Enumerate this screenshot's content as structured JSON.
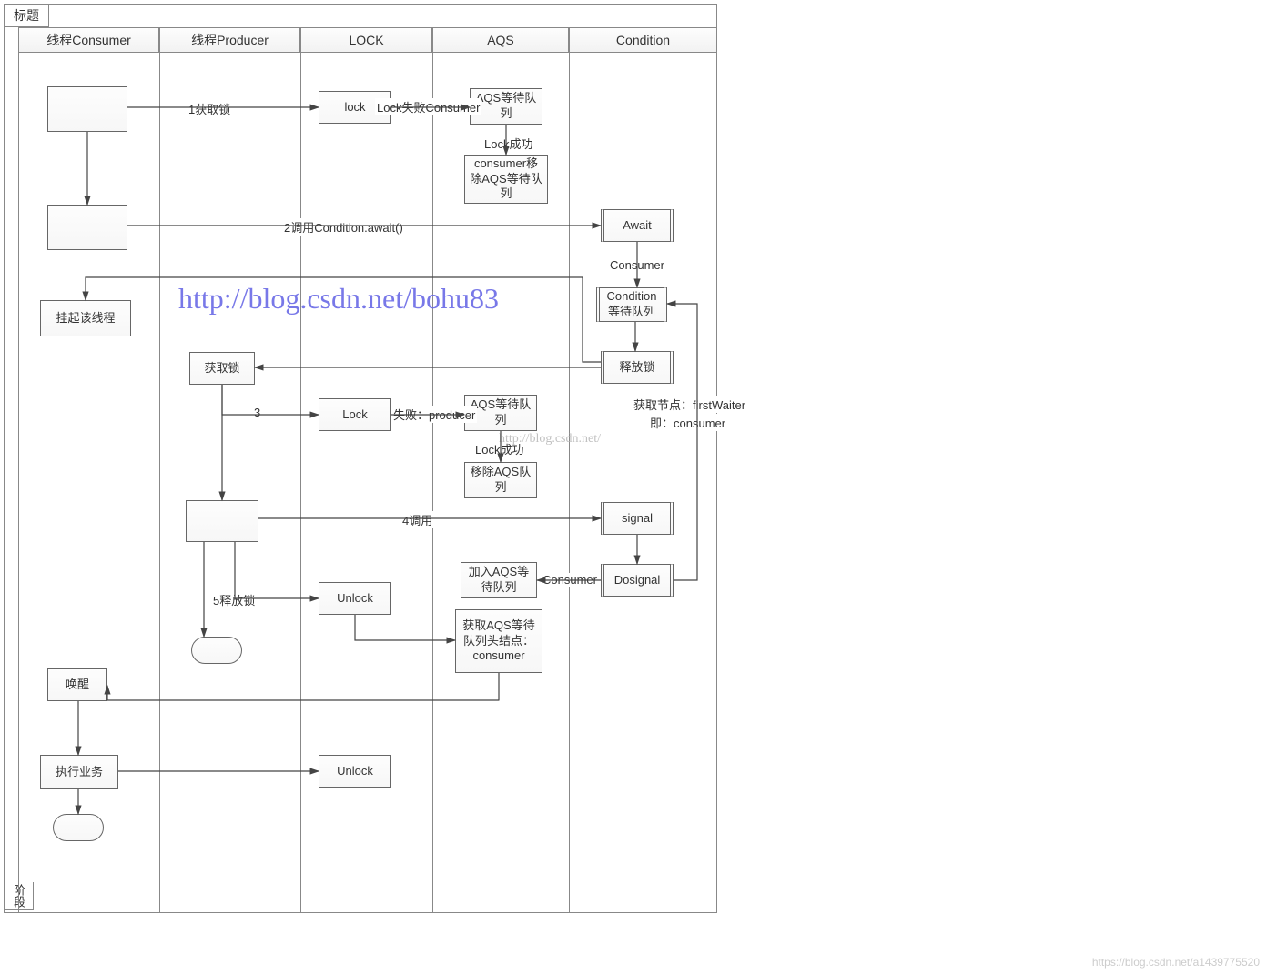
{
  "frame": {
    "title": "标题",
    "inner_title": "阶段"
  },
  "lanes": {
    "consumer": "线程Consumer",
    "producer": "线程Producer",
    "lock": "LOCK",
    "aqs": "AQS",
    "condition": "Condition"
  },
  "nodes": {
    "n_consumer1": "",
    "n_consumer2": "",
    "n_suspend": "挂起该线程",
    "n_wake": "唤醒",
    "n_exec": "执行业务",
    "n_getlock": "获取锁",
    "n_producer_mid": "",
    "n_lock1": "lock",
    "n_lock2": "Lock",
    "n_unlock1": "Unlock",
    "n_unlock2": "Unlock",
    "n_aqs_wait1": "AQS等待队列",
    "n_aqs_consumer_remove": "consumer移除AQS等待队列",
    "n_aqs_wait2": "AQS等待队列",
    "n_aqs_remove2": "移除AQS队列",
    "n_aqs_join": "加入AQS等待队列",
    "n_aqs_gethead": "获取AQS等待队列头结点：consumer",
    "n_await": "Await",
    "n_cond_wait": "Condition 等待队列",
    "n_release": "释放锁",
    "n_signal": "signal",
    "n_dosignal": "Dosignal"
  },
  "labels": {
    "e1": "1获取锁",
    "e_lockfail_consumer": "Lock失败Consumer",
    "e_locksuccess1": "Lock成功",
    "e2": "2调用Condition.await()",
    "e_consumer": "Consumer",
    "e3": "3",
    "e_fail_producer": "失败：producer",
    "e_locksuccess2": "Lock成功",
    "e4": "4调用",
    "e5": "5释放锁",
    "e_consumer2": "Consumer",
    "e_firstwaiter1": "获取节点：firstWaiter",
    "e_firstwaiter2": "即：consumer"
  },
  "watermarks": {
    "main": "http://blog.csdn.net/bohu83",
    "faint": "http://blog.csdn.net/"
  },
  "footer": "https://blog.csdn.net/a1439775520"
}
